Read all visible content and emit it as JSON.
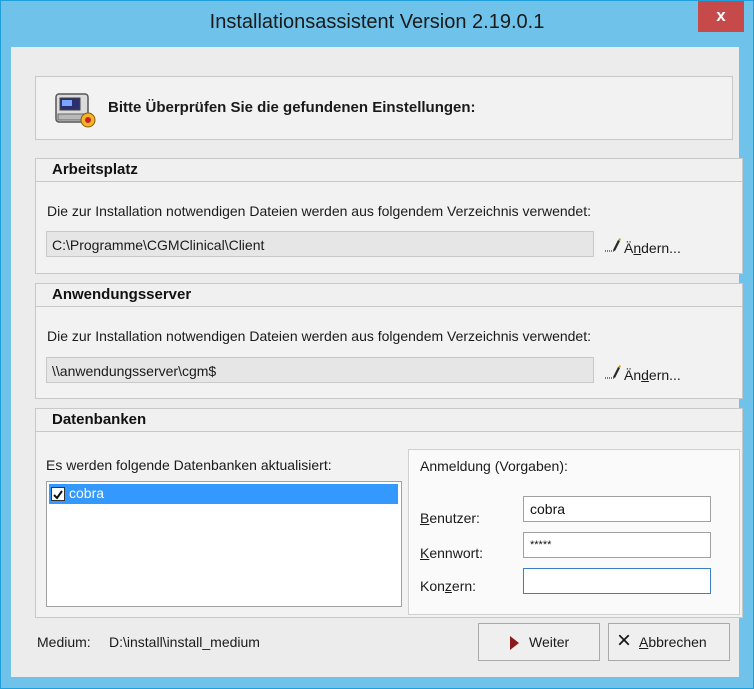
{
  "window": {
    "title": "Installationsassistent  Version 2.19.0.1",
    "close_glyph": "x"
  },
  "header": {
    "message": "Bitte Überprüfen Sie die gefundenen Einstellungen:",
    "icon": "printer-settings-icon"
  },
  "arbeitsplatz": {
    "heading": "Arbeitsplatz",
    "description": "Die zur Installation notwendigen Dateien werden aus folgendem Verzeichnis verwendet:",
    "path": "C:\\Programme\\CGMClinical\\Client",
    "change_label_pre": "Ä",
    "change_label_u": "n",
    "change_label_post": "dern..."
  },
  "anwendungsserver": {
    "heading": "Anwendungsserver",
    "description": "Die zur Installation notwendigen Dateien werden aus folgendem Verzeichnis verwendet:",
    "path": "\\\\anwendungsserver\\cgm$",
    "change_label_pre": "Än",
    "change_label_u": "d",
    "change_label_post": "ern..."
  },
  "datenbanken": {
    "heading": "Datenbanken",
    "list_caption": "Es werden folgende Datenbanken aktualisiert:",
    "items": [
      {
        "label": "cobra",
        "checked": true,
        "selected": true
      }
    ],
    "login": {
      "caption": "Anmeldung (Vorgaben):",
      "user_label": "Benutzer:",
      "password_label": "Kennwort:",
      "group_label": "Konzern:",
      "user_value": "cobra",
      "password_value": "*****",
      "group_value": ""
    }
  },
  "footer": {
    "medium_label": "Medium:",
    "medium_value": "D:\\install\\install_medium",
    "next_label": "Weiter",
    "cancel_label_u": "A",
    "cancel_label_rest": "bbrechen"
  },
  "colors": {
    "titlebar": "#6fc3ea",
    "close": "#c74a4a",
    "selection": "#3399ff"
  }
}
